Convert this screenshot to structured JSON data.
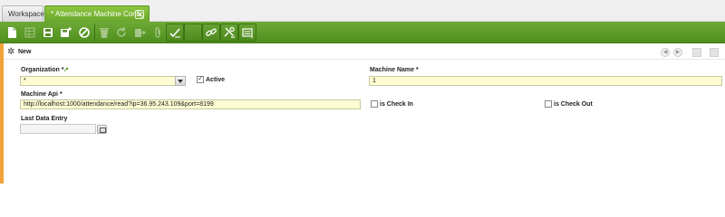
{
  "tabs": {
    "workspace_label": "Workspace",
    "active_label": "* Attendance Machine Config",
    "close_glyph": "✕"
  },
  "toolbar": {
    "icons": [
      "new-record-icon",
      "grid-toggle-icon",
      "save-icon",
      "save-and-new-icon",
      "undo-icon",
      "delete-icon",
      "refresh-icon",
      "export-icon",
      "attachment-icon",
      "process-icon",
      "link-icon",
      "settings-icon",
      "more-menu-icon"
    ]
  },
  "header": {
    "new_label": "New"
  },
  "form": {
    "organization_label": "Organization *",
    "organization_value": "*",
    "active_label": "Active",
    "active_checked": true,
    "machine_name_label": "Machine Name *",
    "machine_name_value": "1",
    "machine_api_label": "Machine Api *",
    "machine_api_value": "http://localhost:1000/attendance/read?ip=36.95.243.109&port=8199",
    "is_check_in_label": "is Check In",
    "is_check_out_label": "is Check Out",
    "last_data_entry_label": "Last Data Entry",
    "last_data_entry_value": ""
  },
  "colors": {
    "brand_green": "#5f9c2b",
    "accent_orange": "#f1a33a",
    "mandatory_field": "#fdfcd2"
  }
}
